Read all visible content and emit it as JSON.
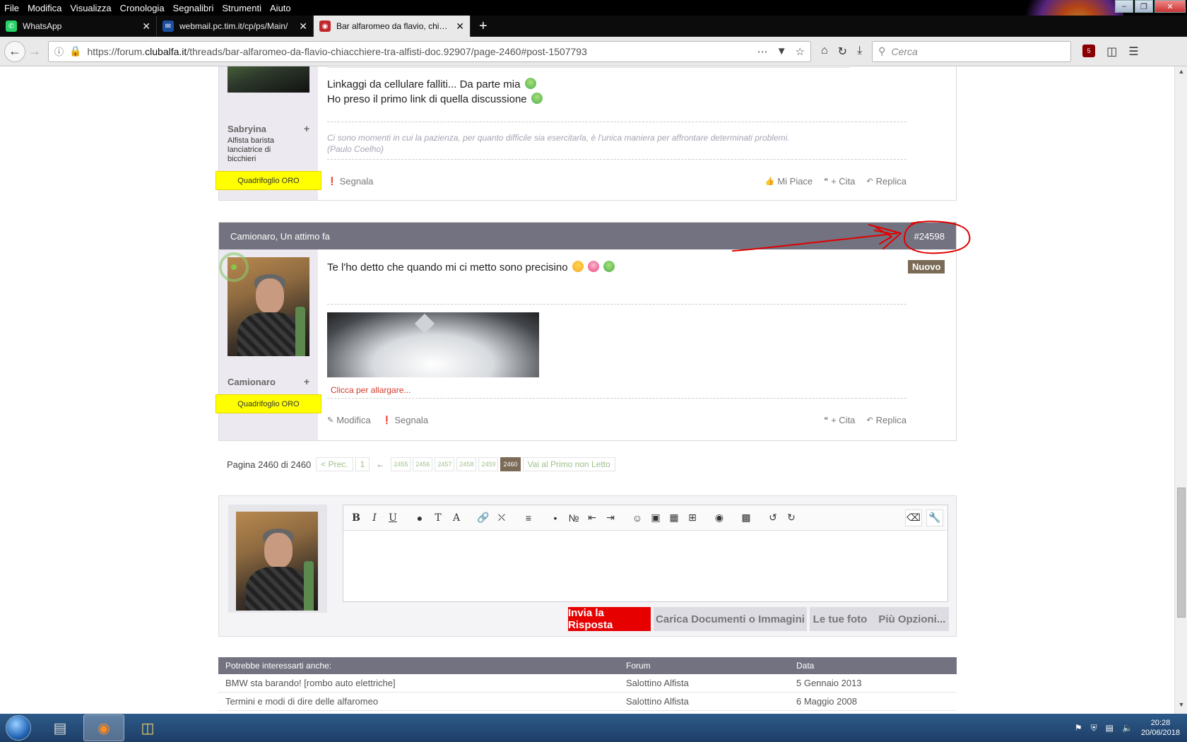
{
  "menubar": {
    "items": [
      "File",
      "Modifica",
      "Visualizza",
      "Cronologia",
      "Segnalibri",
      "Strumenti",
      "Aiuto"
    ]
  },
  "tabs": [
    {
      "title": "WhatsApp",
      "icon": "whatsapp-icon",
      "active": false
    },
    {
      "title": "webmail.pc.tim.it/cp/ps/Main/",
      "icon": "mail-icon",
      "active": false
    },
    {
      "title": "Bar alfaromeo da flavio, chiacc",
      "icon": "clubalfa-icon",
      "active": true
    }
  ],
  "urlbar": {
    "prefix": "https://forum.",
    "domain": "clubalfa.it",
    "path": "/threads/bar-alfaromeo-da-flavio-chiacchiere-tra-alfisti-doc.92907/page-2460#post-1507793"
  },
  "search": {
    "placeholder": "Cerca"
  },
  "ublock_count": "5",
  "post1": {
    "username": "Sabryina",
    "user_title": "Alfista barista lanciatrice di bicchieri",
    "badge": "Quadrifoglio ORO",
    "text_line1": "Linkaggi da cellulare falliti... Da parte mia",
    "text_line2": "Ho preso il primo link di quella discussione",
    "signature_line1": "Ci sono momenti in cui la pazienza, per quanto difficile sia esercitarla, è l'unica maniera per affrontare determinati problemi.",
    "signature_line2": "(Paulo Coelho)",
    "action_report": "Segnala",
    "action_like": "Mi Piace",
    "action_quote": "+ Cita",
    "action_reply": "Replica"
  },
  "post2": {
    "header": "Camionaro, Un attimo fa",
    "permalink": "#24598",
    "new_label": "Nuovo",
    "username": "Camionaro",
    "badge": "Quadrifoglio ORO",
    "text": "Te l'ho detto che quando mi ci metto sono precisino",
    "attachment_link": "Clicca per allargare...",
    "action_edit": "Modifica",
    "action_report": "Segnala",
    "action_quote": "+ Cita",
    "action_reply": "Replica"
  },
  "pagination": {
    "label": "Pagina 2460 di 2460",
    "prev": "< Prec.",
    "first": "1",
    "gap": "←",
    "pages": [
      "2455",
      "2456",
      "2457",
      "2458",
      "2459"
    ],
    "current": "2460",
    "jump": "Vai al Primo non Letto"
  },
  "reply": {
    "submit": "Invia la Risposta",
    "upload": "Carica Documenti o Immagini",
    "photos": "Le tue foto",
    "more": "Più Opzioni..."
  },
  "related": {
    "heading": "Potrebbe interessarti anche:",
    "col_forum": "Forum",
    "col_date": "Data",
    "rows": [
      {
        "title": "BMW sta barando! [rombo auto elettriche]",
        "forum": "Salottino Alfista",
        "date": "5 Gennaio 2013"
      },
      {
        "title": "Termini e modi di dire delle alfaromeo",
        "forum": "Salottino Alfista",
        "date": "6 Maggio 2008"
      }
    ]
  },
  "taskbar": {
    "time": "20:28",
    "date": "20/06/2018"
  },
  "colors": {
    "header_bg": "#737280",
    "badge_yellow": "#ffff00",
    "submit_red": "#e60000",
    "new_brown": "#7a6a56",
    "annotation_red": "#e00000"
  }
}
